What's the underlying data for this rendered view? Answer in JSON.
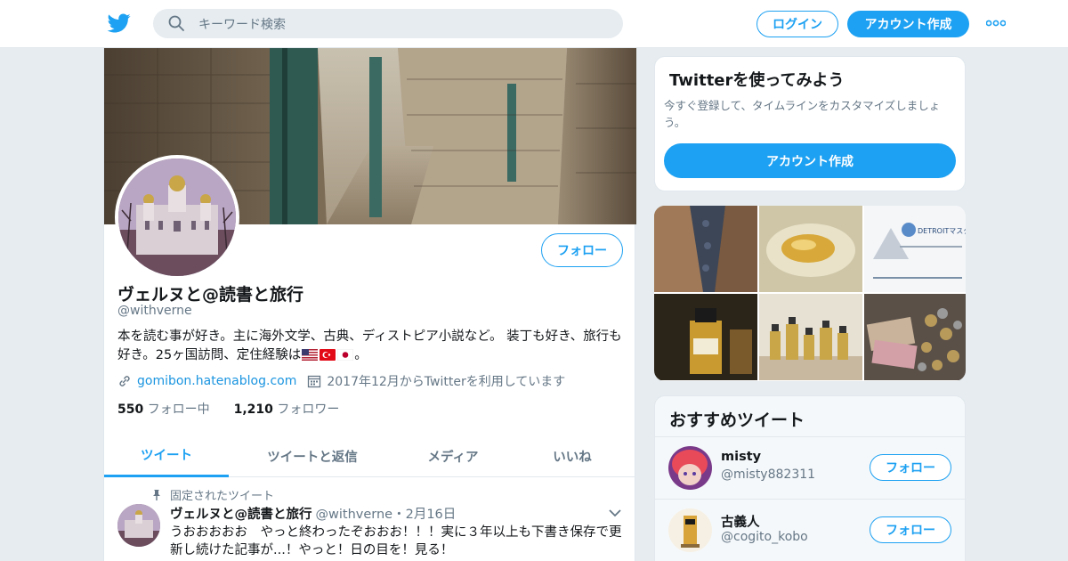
{
  "colors": {
    "accent": "#1da1f2",
    "background": "#e6ecf0",
    "text": "#14171a",
    "muted": "#657786",
    "link": "#1b95e0"
  },
  "header": {
    "logo_icon": "twitter-bird-icon",
    "search_placeholder": "キーワード検索",
    "login_label": "ログイン",
    "signup_label": "アカウント作成",
    "more_icon": "more-dots-icon"
  },
  "profile": {
    "follow_label": "フォロー",
    "name": "ヴェルヌと@読書と旅行",
    "handle": "@withverne",
    "bio": "本を読む事が好き。主に海外文学、古典、ディストピア小説など。 装丁も好き、旅行も好き。25ヶ国訪問、定住経験は",
    "bio_flags": [
      "us-flag-icon",
      "turkey-flag-icon",
      "japan-flag-icon"
    ],
    "bio_end": "。",
    "website": "gomibon.hatenablog.com",
    "joined": "2017年12月からTwitterを利用しています",
    "following_count": "550",
    "following_label": "フォロー中",
    "followers_count": "1,210",
    "followers_label": "フォロワー"
  },
  "tabs": [
    {
      "label": "ツイート",
      "active": true
    },
    {
      "label": "ツイートと返信",
      "active": false
    },
    {
      "label": "メディア",
      "active": false
    },
    {
      "label": "いいね",
      "active": false
    }
  ],
  "pinned_tweet": {
    "pinned_label": "固定されたツイート",
    "author_name": "ヴェルヌと@読書と旅行",
    "author_handle": "@withverne",
    "date": "・2月16日",
    "text": "うおおおおお　やっと終わったぞおおお！！！実に３年以上も下書き保存で更新し続けた記事が...！やっと！日の目を！見る！"
  },
  "signup_card": {
    "title": "Twitterを使ってみよう",
    "subtitle": "今すぐ登録して、タイムラインをカスタマイズしましょう。",
    "button_label": "アカウント作成"
  },
  "media": {
    "thumbnail_text": "DETROITマスター"
  },
  "recommended": {
    "title": "おすすめツイート",
    "follow_label": "フォロー",
    "users": [
      {
        "name": "misty",
        "handle": "@misty882311"
      },
      {
        "name": "古義人",
        "handle": "@cogito_kobo"
      }
    ]
  }
}
